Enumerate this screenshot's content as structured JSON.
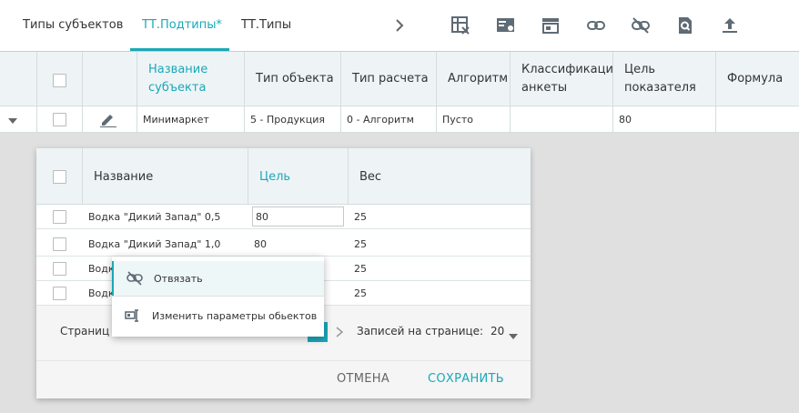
{
  "tabs": [
    {
      "label": "Типы субъектов",
      "active": false
    },
    {
      "label": "ТТ.Подтипы*",
      "active": true
    },
    {
      "label": "ТТ.Типы",
      "active": false
    }
  ],
  "toolbar_icons": [
    "chevron-right-icon",
    "table-clear-icon",
    "card-user-icon",
    "store-icon",
    "link-icon",
    "unlink-icon",
    "doc-search-icon",
    "upload-icon"
  ],
  "main_table": {
    "columns": [
      "Название субъекта",
      "Тип объекта",
      "Тип расчета",
      "Алгоритм",
      "Классификация анкеты",
      "Цель показателя",
      "Формула"
    ],
    "row": {
      "name": "Минимаркет",
      "object_type": "5 - Продукция",
      "calc_type": "0 - Алгоритм",
      "algorithm": "Пусто",
      "classification": "",
      "target": "80",
      "formula": ""
    }
  },
  "dialog": {
    "columns": [
      "Название",
      "Цель",
      "Вес"
    ],
    "rows": [
      {
        "name": "Водка \"Дикий Запад\" 0,5",
        "target": "80",
        "weight": "25"
      },
      {
        "name": "Водка \"Дикий Запад\" 1,0",
        "target": "80",
        "weight": "25"
      },
      {
        "name": "Водк",
        "target": "",
        "weight": "25"
      },
      {
        "name": "Водк",
        "target": "",
        "weight": "25"
      }
    ],
    "pager": {
      "page_label": "Страниц",
      "per_page_label": "Записей на странице:",
      "per_page_value": "20"
    },
    "cancel_label": "ОТМЕНА",
    "save_label": "СОХРАНИТЬ"
  },
  "context_menu": {
    "items": [
      "Отвязать",
      "Изменить параметры обьектов"
    ]
  },
  "colors": {
    "accent": "#1aa8b8"
  }
}
